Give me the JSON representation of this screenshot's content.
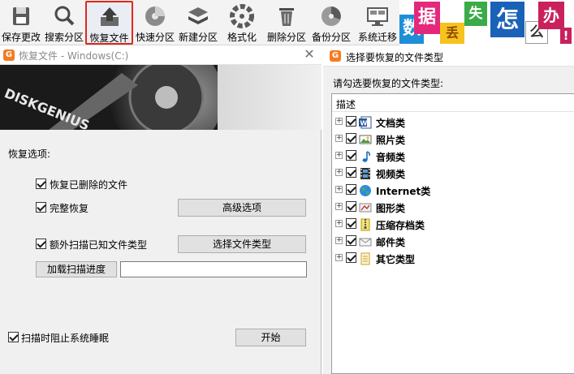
{
  "toolbar": {
    "buttons": [
      {
        "label": "保存更改",
        "icon": "save-disk-icon"
      },
      {
        "label": "搜索分区",
        "icon": "search-partition-icon"
      },
      {
        "label": "恢复文件",
        "icon": "recover-files-icon"
      },
      {
        "label": "快速分区",
        "icon": "quick-partition-icon"
      },
      {
        "label": "新建分区",
        "icon": "new-partition-icon"
      },
      {
        "label": "格式化",
        "icon": "format-icon"
      },
      {
        "label": "删除分区",
        "icon": "delete-partition-icon"
      },
      {
        "label": "备份分区",
        "icon": "backup-partition-icon"
      },
      {
        "label": "系统迁移",
        "icon": "system-migrate-icon"
      }
    ],
    "active_index": 2,
    "active_border_color": "#e0281c"
  },
  "banner": {
    "chars": [
      "数",
      "据",
      "丢",
      "失",
      "怎",
      "么",
      "办",
      "!"
    ],
    "colors": [
      "#1e8fd6",
      "#e4287b",
      "#f7c21d",
      "#3aab48",
      "#1a62b8",
      "#ffffff",
      "#c9215c"
    ]
  },
  "dialog": {
    "title": "恢复文件 - Windows(C:)",
    "logo_text": "DISKGENIUS",
    "section_label": "恢复选项:",
    "options": {
      "recover_deleted": "恢复已删除的文件",
      "full_recovery": "完整恢复",
      "extra_scan": "额外扫描已知文件类型",
      "prevent_sleep": "扫描时阻止系统睡眠"
    },
    "buttons": {
      "advanced": "高级选项",
      "select_types": "选择文件类型",
      "load_progress": "加载扫描进度",
      "start": "开始"
    },
    "progress_path_value": ""
  },
  "file_types_panel": {
    "title": "选择要恢复的文件类型",
    "prompt": "请勾选要恢复的文件类型:",
    "column_header": "描述",
    "items": [
      {
        "label": "文档类",
        "icon": "word-document-icon"
      },
      {
        "label": "照片类",
        "icon": "photo-icon"
      },
      {
        "label": "音频类",
        "icon": "music-note-icon"
      },
      {
        "label": "视频类",
        "icon": "film-strip-icon"
      },
      {
        "label": "Internet类",
        "icon": "internet-globe-icon"
      },
      {
        "label": "图形类",
        "icon": "graphics-icon"
      },
      {
        "label": "压缩存档类",
        "icon": "zip-archive-icon"
      },
      {
        "label": "邮件类",
        "icon": "mail-envelope-icon"
      },
      {
        "label": "其它类型",
        "icon": "other-file-icon"
      }
    ]
  }
}
